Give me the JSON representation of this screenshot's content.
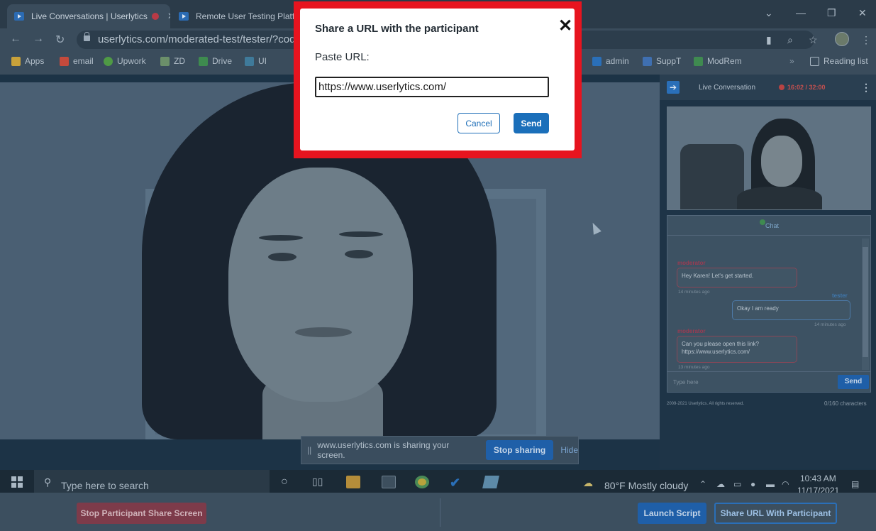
{
  "browser": {
    "tabs": [
      {
        "label": "Live Conversations | Userlytics",
        "recording": true
      },
      {
        "label": "Remote User Testing Platfo"
      }
    ],
    "url": "userlytics.com/moderated-test/tester/?code=a",
    "bookmarks": [
      {
        "label": "Apps",
        "color": "#c9a23a"
      },
      {
        "label": "email",
        "color": "#c44a3c"
      },
      {
        "label": "Upwork",
        "color": "#4f9a45"
      },
      {
        "label": "ZD",
        "color": "#6b8f6a"
      },
      {
        "label": "Drive",
        "color": "#3e8b4f"
      },
      {
        "label": "UI",
        "color": "#3f7a9a"
      },
      {
        "label": "admin",
        "color": "#2a6fb8"
      },
      {
        "label": "SuppT",
        "color": "#3f6fb0"
      },
      {
        "label": "ModRem",
        "color": "#3f8a50"
      },
      {
        "label": "Reading list",
        "color": "#aab8c4"
      }
    ]
  },
  "share_bar": {
    "grip": "||",
    "message": "www.userlytics.com is sharing your screen.",
    "stop_label": "Stop sharing",
    "hide_label": "Hide"
  },
  "side_panel": {
    "title": "Live Conversation",
    "timer": "16:02 / 32:00",
    "menu": "⋮",
    "chat_label": "Chat",
    "messages": [
      {
        "sender": "moderator",
        "role": "mod",
        "text": "Hey Karen! Let's get started.",
        "time": "14 minutes ago"
      },
      {
        "sender": "tester",
        "role": "tst",
        "text": "Okay I am ready",
        "time": "14 minutes ago"
      },
      {
        "sender": "moderator",
        "role": "mod",
        "text": "Can you please open this link? https://www.userlytics.com/",
        "time": "13 minutes ago"
      }
    ],
    "input_placeholder": "Type here",
    "send_label": "Send",
    "copyright": "2009-2021 Userlytics. All rights reserved.",
    "char_count": "0/160 characters"
  },
  "taskbar": {
    "search_placeholder": "Type here to search",
    "weather": "80°F  Mostly cloudy",
    "time": "10:43 AM",
    "date": "11/17/2021"
  },
  "actions": {
    "stop_share": "Stop Participant Share Screen",
    "launch_script": "Launch Script",
    "share_url": "Share URL With Participant"
  },
  "modal": {
    "title": "Share a URL with the participant",
    "close": "✕",
    "label": "Paste URL:",
    "url_value": "https://www.userlytics.com/",
    "cancel_label": "Cancel",
    "send_label": "Send"
  },
  "colors": {
    "highlight": "#e7141f",
    "primary": "#1b6fba",
    "danger": "#7d3b4a"
  }
}
